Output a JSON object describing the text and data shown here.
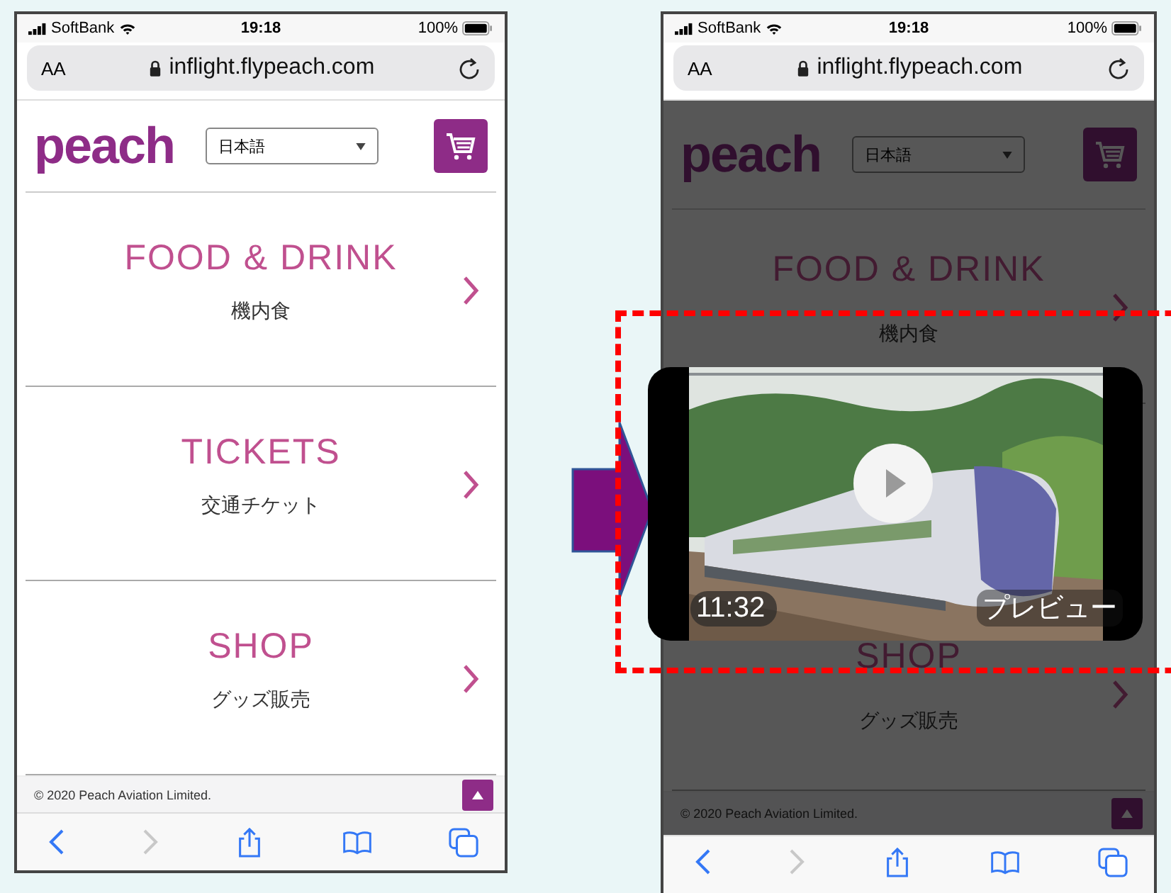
{
  "phones": [
    {
      "dimmed": false,
      "status_bar": {
        "carrier": "SoftBank",
        "time": "19:18",
        "battery": "100%"
      },
      "address_bar": {
        "text_size": "AA",
        "url": "inflight.flypeach.com"
      },
      "header": {
        "logo": "peach",
        "language": "日本語"
      },
      "menu": [
        {
          "title": "FOOD & DRINK",
          "subtitle": "機内食"
        },
        {
          "title": "TICKETS",
          "subtitle": "交通チケット"
        },
        {
          "title": "SHOP",
          "subtitle": "グッズ販売"
        }
      ],
      "footer": "© 2020 Peach Aviation Limited."
    },
    {
      "dimmed": true,
      "status_bar": {
        "carrier": "SoftBank",
        "time": "19:18",
        "battery": "100%"
      },
      "address_bar": {
        "text_size": "AA",
        "url": "inflight.flypeach.com"
      },
      "header": {
        "logo": "peach",
        "language": "日本語"
      },
      "menu": [
        {
          "title": "FOOD & DRINK",
          "subtitle": "機内食"
        },
        {
          "title": "SHOP",
          "subtitle": "グッズ販売"
        }
      ],
      "footer": "© 2020 Peach Aviation Limited.",
      "video": {
        "duration": "11:32",
        "label": "プレビュー"
      }
    }
  ]
}
